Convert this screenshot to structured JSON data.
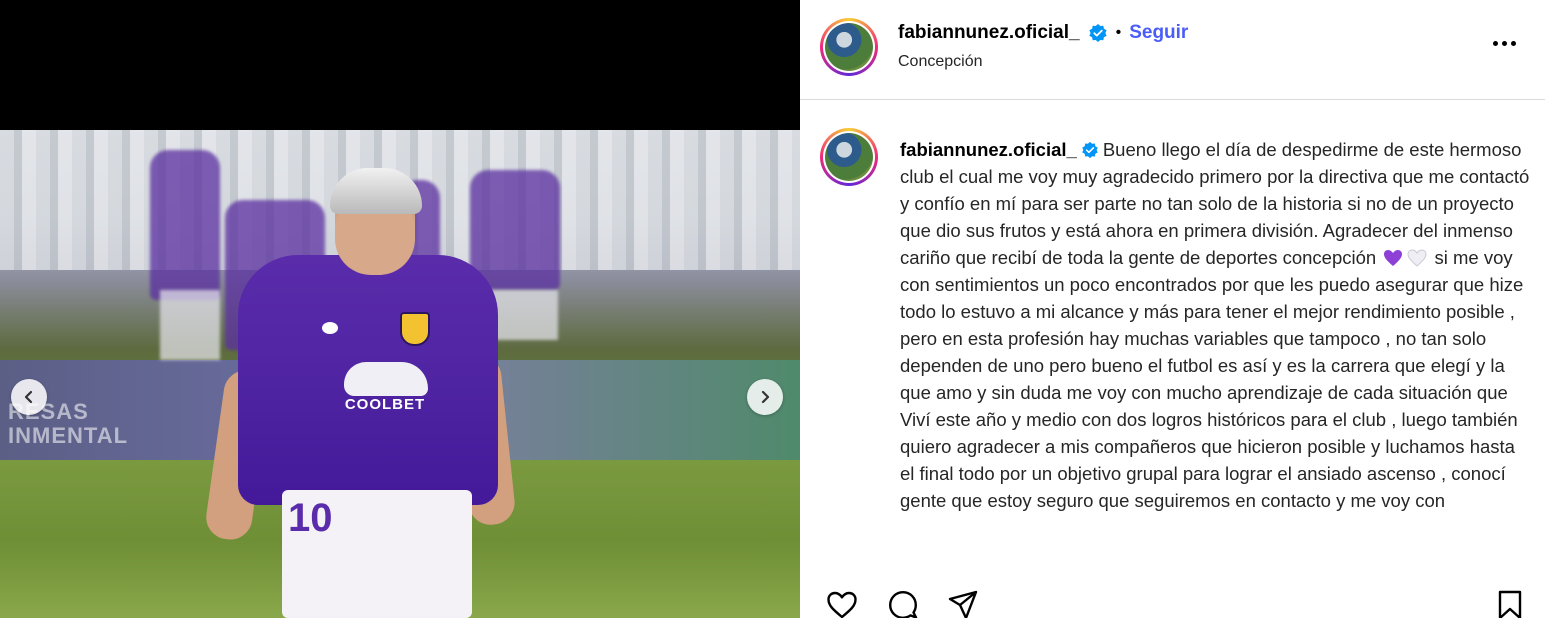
{
  "post": {
    "username": "fabiannunez.oficial_",
    "follow_label": "Seguir",
    "separator": "•",
    "location": "Concepción"
  },
  "caption": {
    "username": "fabiannunez.oficial_",
    "text_part1": "Bueno llego el día de despedirme de este hermoso club el cual me voy muy agradecido primero por la directiva que me contactó y confío en mí para ser parte no tan solo de la historia si no de un proyecto que dio sus frutos y está ahora en primera división. Agradecer del inmenso cariño que recibí de toda la gente de deportes concepción",
    "emoji_1": "purple-heart-icon",
    "emoji_2": "white-heart-icon",
    "text_part2": "si me voy con sentimientos un poco encontrados por que les puedo asegurar que hize todo lo estuvo a mi alcance y más para tener el mejor rendimiento posible , pero en esta profesión hay muchas variables que tampoco , no tan solo dependen de uno pero bueno el futbol es así y es la carrera que elegí y la que amo y sin duda me voy con mucho aprendizaje de cada situación que Viví este año y medio con dos logros históricos para el club , luego también quiero agradecer a mis compañeros que hicieron posible y luchamos hasta el final todo por un objetivo grupal para lograr el ansiado ascenso , conocí gente que estoy seguro que seguiremos en contacto y me voy con"
  },
  "media": {
    "shirt_sponsor": "COOLBET",
    "shorts_number": "10",
    "ad_board_text": "RESAS\nINMENTAL"
  },
  "icons": {
    "more": "more-options-icon",
    "prev": "chevron-left-icon",
    "next": "chevron-right-icon",
    "like": "heart-icon",
    "comment": "comment-icon",
    "share": "share-icon",
    "save": "bookmark-icon",
    "verified": "verified-badge-icon"
  },
  "colors": {
    "follow": "#4a5df9",
    "verified": "#0095f6",
    "shirt": "#5a2cab"
  }
}
